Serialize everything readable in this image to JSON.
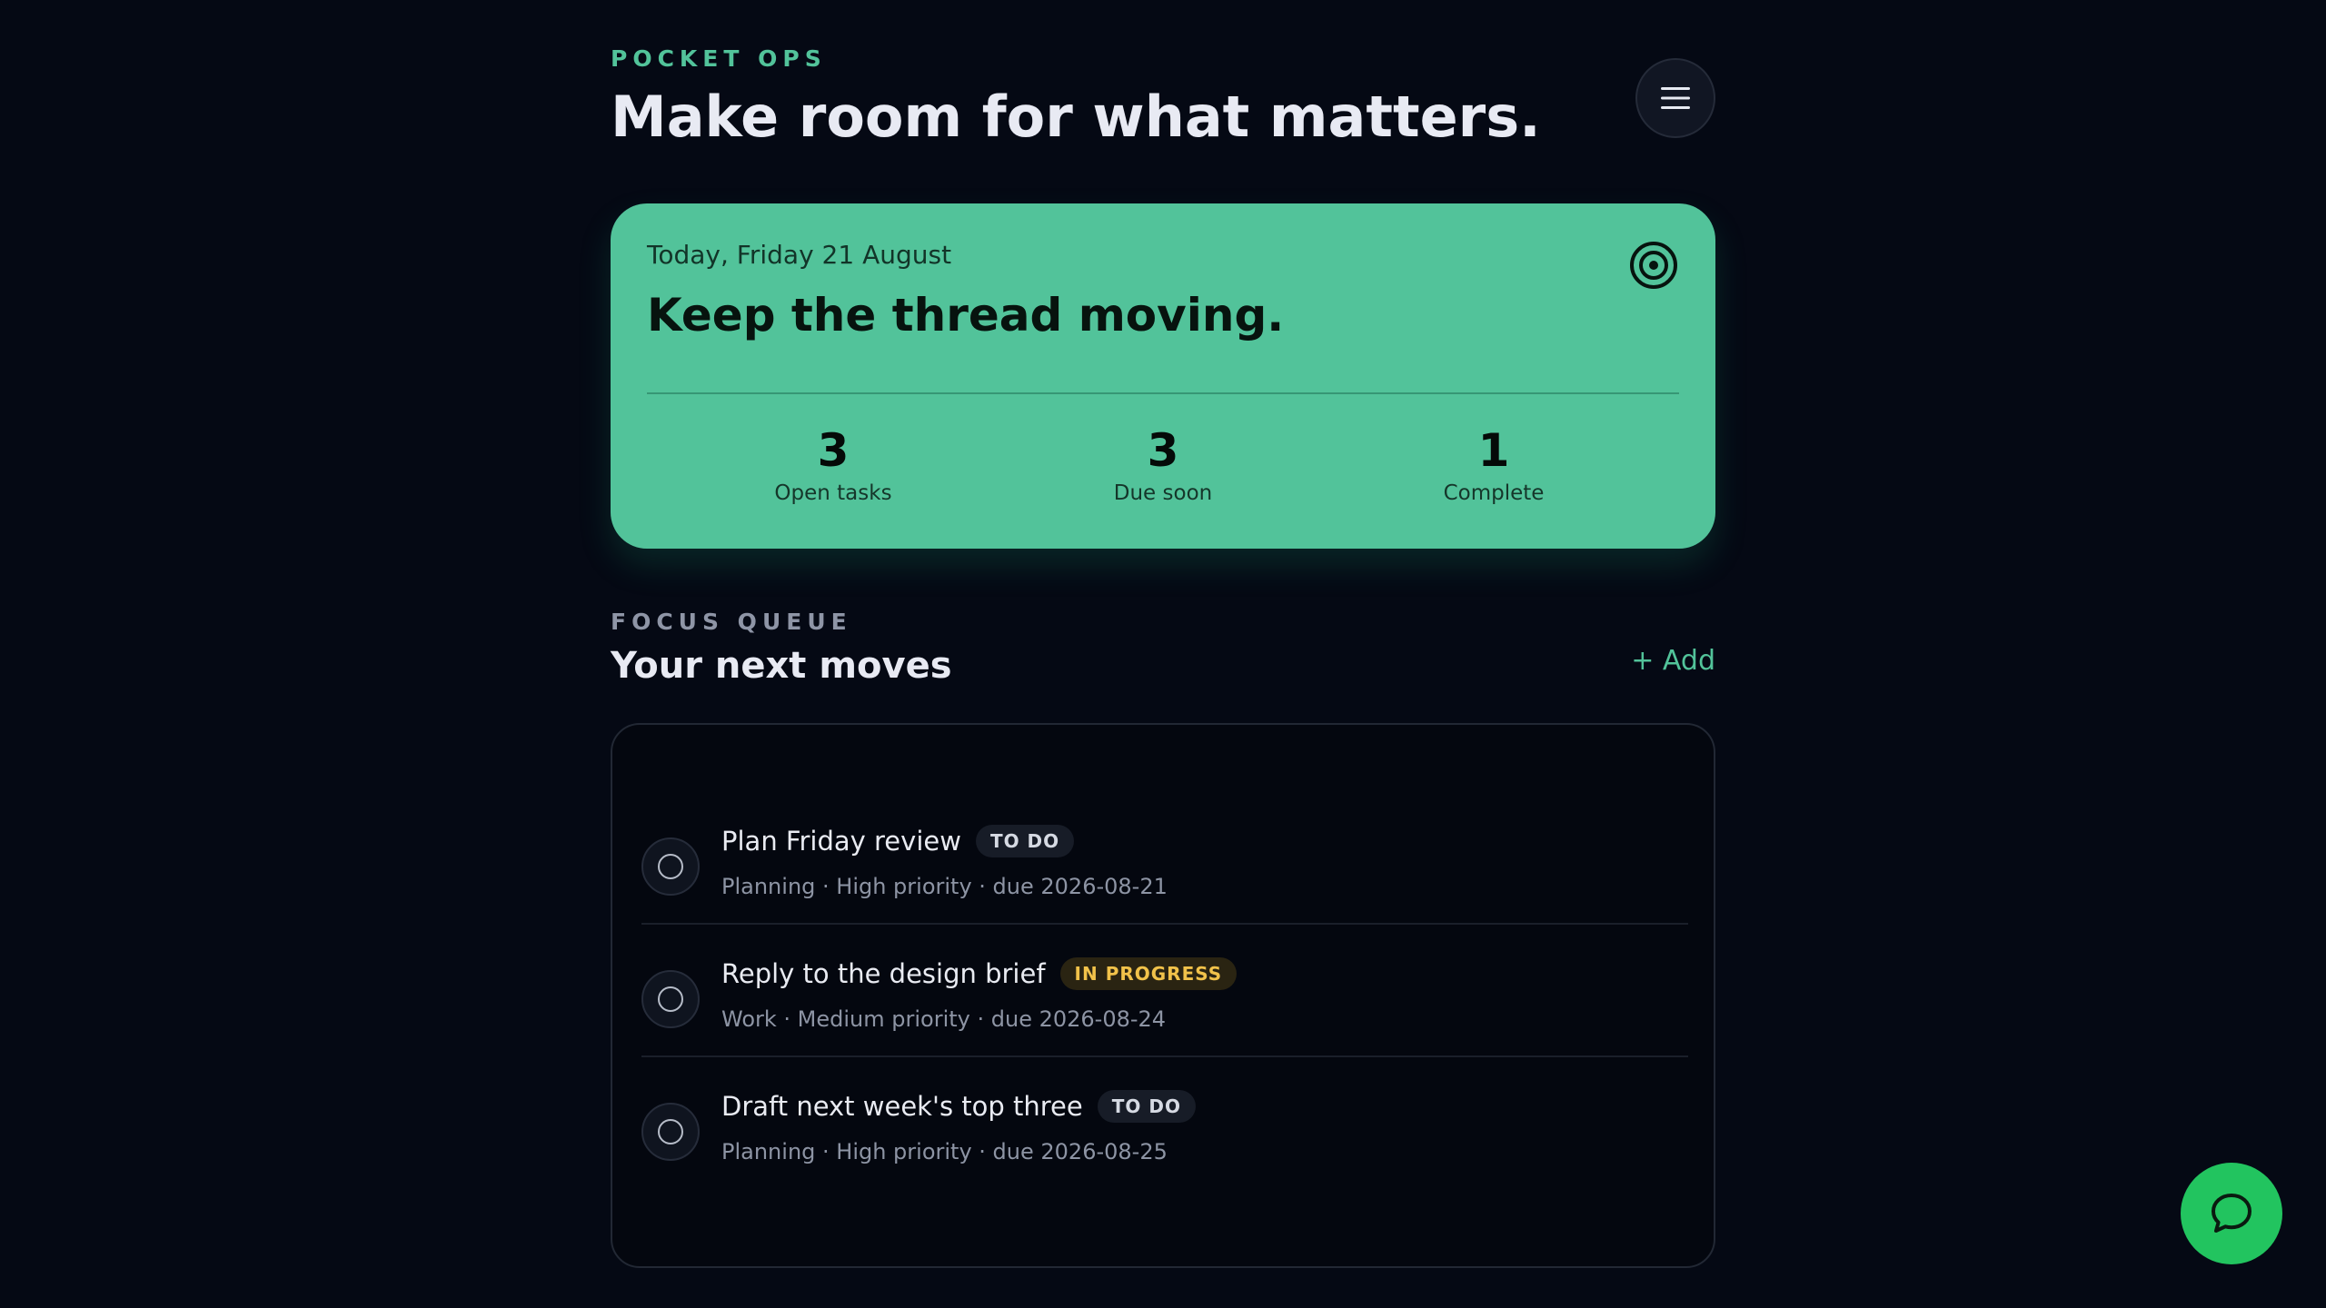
{
  "header": {
    "eyebrow": "POCKET OPS",
    "title": "Make room for what matters."
  },
  "hero": {
    "date": "Today, Friday 21 August",
    "title": "Keep the thread moving.",
    "stats": [
      {
        "value": "3",
        "label": "Open tasks"
      },
      {
        "value": "3",
        "label": "Due soon"
      },
      {
        "value": "1",
        "label": "Complete"
      }
    ]
  },
  "queue": {
    "eyebrow": "FOCUS QUEUE",
    "title": "Your next moves",
    "add_label": "+ Add",
    "tasks": [
      {
        "title": "Plan Friday review",
        "status": "TO DO",
        "meta": "Planning · High priority · due 2026-08-21"
      },
      {
        "title": "Reply to the design brief",
        "status": "IN PROGRESS",
        "meta": "Work · Medium priority · due 2026-08-24"
      },
      {
        "title": "Draft next week's top three",
        "status": "TO DO",
        "meta": "Planning · High priority · due 2026-08-25"
      }
    ]
  },
  "icons": {
    "menu": "menu-icon",
    "target": "target-icon",
    "chat": "chat-bubble-icon"
  },
  "colors": {
    "background": "#050914",
    "accent": "#52c39a",
    "fab": "#22c45f",
    "in_progress": "#f1c24a"
  }
}
